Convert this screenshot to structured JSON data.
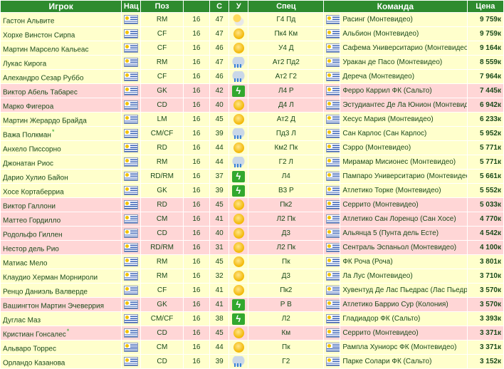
{
  "headers": {
    "player": "Игрок",
    "nat": "Нац",
    "pos": "Поз",
    "age": "",
    "s": "С",
    "u": "У",
    "spec": "Спец",
    "team": "Команда",
    "price": "Цена"
  },
  "rows": [
    {
      "name": "Гастон Альвите",
      "star": "",
      "pos": "RM",
      "age": "16",
      "s": "47",
      "weather": "cloud-sun",
      "spec": "Г4 Пд",
      "team": "Расинг (Монтевидео)",
      "price": "9 759к",
      "hl": "y"
    },
    {
      "name": "Хорхе Винстон Сирпа",
      "star": "",
      "pos": "CF",
      "age": "16",
      "s": "47",
      "weather": "sunny",
      "spec": "Пк4 Км",
      "team": "Альбион (Монтевидео)",
      "price": "9 759к",
      "hl": "y"
    },
    {
      "name": "Мартин Марсело Кальеас",
      "star": "",
      "pos": "CF",
      "age": "16",
      "s": "46",
      "weather": "sunny",
      "spec": "У4 Д",
      "team": "Сафема Университарио (Монтевидео)",
      "price": "9 164к",
      "hl": "y"
    },
    {
      "name": "Лукас Кирога",
      "star": "",
      "pos": "RM",
      "age": "16",
      "s": "47",
      "weather": "rain",
      "spec": "Ат2 Пд2",
      "team": "Уракан де Пасо (Монтевидео)",
      "price": "8 559к",
      "hl": "y"
    },
    {
      "name": "Алехандро Сезар Руббо",
      "star": "",
      "pos": "CF",
      "age": "16",
      "s": "46",
      "weather": "rain",
      "spec": "Ат2 Г2",
      "team": "Дереча (Монтевидео)",
      "price": "7 964к",
      "hl": "y"
    },
    {
      "name": "Виктор Абель Табарес",
      "star": "",
      "pos": "GK",
      "age": "16",
      "s": "42",
      "weather": "storm",
      "spec": "Л4 Р",
      "team": "Ферро Каррил ФК (Сальто)",
      "price": "7 445к",
      "hl": "p"
    },
    {
      "name": "Марко Фигероа",
      "star": "",
      "pos": "CD",
      "age": "16",
      "s": "40",
      "weather": "sunny",
      "spec": "Д4 Л",
      "team": "Эстудиантес Де Ла Юнион (Монтевидео)",
      "price": "6 942к",
      "hl": "p"
    },
    {
      "name": "Мартин Жерардо Брайда",
      "star": "",
      "pos": "LM",
      "age": "16",
      "s": "45",
      "weather": "sunny",
      "spec": "Ат2 Д",
      "team": "Хесус Мария (Монтевидео)",
      "price": "6 233к",
      "hl": "y"
    },
    {
      "name": "Важа Полкман",
      "star": "*",
      "pos": "CM/CF",
      "age": "16",
      "s": "39",
      "weather": "rain",
      "spec": "Пд3 Л",
      "team": "Сан Карлос (Сан Карлос)",
      "price": "5 952к",
      "hl": "y"
    },
    {
      "name": "Анхело Писсорно",
      "star": "",
      "pos": "RD",
      "age": "16",
      "s": "44",
      "weather": "sunny",
      "spec": "Км2 Пк",
      "team": "Сэрро (Монтевидео)",
      "price": "5 771к",
      "hl": "y"
    },
    {
      "name": "Джонатан Риос",
      "star": "",
      "pos": "RM",
      "age": "16",
      "s": "44",
      "weather": "rain",
      "spec": "Г2 Л",
      "team": "Мирамар Мисионес (Монтевидео)",
      "price": "5 771к",
      "hl": "y"
    },
    {
      "name": "Дарио Хулио Байон",
      "star": "",
      "pos": "RD/RM",
      "age": "16",
      "s": "37",
      "weather": "storm",
      "spec": "Л4",
      "team": "Пампаро Университарио (Монтевидео)",
      "price": "5 661к",
      "hl": "y"
    },
    {
      "name": "Хосе Кортаберриа",
      "star": "",
      "pos": "GK",
      "age": "16",
      "s": "39",
      "weather": "storm",
      "spec": "В3 Р",
      "team": "Атлетико Торке (Монтевидео)",
      "price": "5 552к",
      "hl": "y"
    },
    {
      "name": "Виктор Галлони",
      "star": "",
      "pos": "RD",
      "age": "16",
      "s": "45",
      "weather": "sunny",
      "spec": "Пк2",
      "team": "Серрито (Монтевидео)",
      "price": "5 033к",
      "hl": "p"
    },
    {
      "name": "Маттео Гордилло",
      "star": "",
      "pos": "CM",
      "age": "16",
      "s": "41",
      "weather": "sunny",
      "spec": "Л2 Пк",
      "team": "Атлетико Сан Лоренцо (Сан Хосе)",
      "price": "4 770к",
      "hl": "p"
    },
    {
      "name": "Родольфо Гиллен",
      "star": "",
      "pos": "CD",
      "age": "16",
      "s": "40",
      "weather": "sunny",
      "spec": "Д3",
      "team": "Альянца 5 (Пунта дель Есте)",
      "price": "4 542к",
      "hl": "p"
    },
    {
      "name": "Нестор дель Рио",
      "star": "",
      "pos": "RD/RM",
      "age": "16",
      "s": "31",
      "weather": "sunny",
      "spec": "Л2 Пк",
      "team": "Сентраль Эспаньол (Монтевидео)",
      "price": "4 100к",
      "hl": "p"
    },
    {
      "name": "Матиас Мело",
      "star": "",
      "pos": "RM",
      "age": "16",
      "s": "45",
      "weather": "sunny",
      "spec": "Пк",
      "team": "ФК Роча (Роча)",
      "price": "3 801к",
      "hl": "y"
    },
    {
      "name": "Клаудио Херман Морнироли",
      "star": "",
      "pos": "RM",
      "age": "16",
      "s": "32",
      "weather": "sunny",
      "spec": "Д3",
      "team": "Ла Лус (Монтевидео)",
      "price": "3 710к",
      "hl": "y"
    },
    {
      "name": "Ренцо Даниэль Валверде",
      "star": "",
      "pos": "CF",
      "age": "16",
      "s": "41",
      "weather": "sunny",
      "spec": "Пк2",
      "team": "Хувентуд Де Лас Пьедрас (Лас Пьедрас)",
      "price": "3 570к",
      "hl": "y"
    },
    {
      "name": "Вашингтон Мартин Эчеверрия",
      "star": "",
      "pos": "GK",
      "age": "16",
      "s": "41",
      "weather": "storm",
      "spec": "Р В",
      "team": "Атлетико Баррио Сур (Колония)",
      "price": "3 570к",
      "hl": "p"
    },
    {
      "name": "Дуглас Маз",
      "star": "",
      "pos": "CM/CF",
      "age": "16",
      "s": "38",
      "weather": "storm",
      "spec": "Л2",
      "team": "Гладиадор ФК (Сальто)",
      "price": "3 393к",
      "hl": "y"
    },
    {
      "name": "Кристиан Гонсалес",
      "star": "*",
      "pos": "CD",
      "age": "16",
      "s": "45",
      "weather": "sunny",
      "spec": "Км",
      "team": "Серрито (Монтевидео)",
      "price": "3 371к",
      "hl": "p"
    },
    {
      "name": "Альваро Торрес",
      "star": "",
      "pos": "CM",
      "age": "16",
      "s": "44",
      "weather": "sunny",
      "spec": "Пк",
      "team": "Рампла Хуниорс ФК (Монтевидео)",
      "price": "3 371к",
      "hl": "y"
    },
    {
      "name": "Орландо Казанова",
      "star": "",
      "pos": "CD",
      "age": "16",
      "s": "39",
      "weather": "rain",
      "spec": "Г2",
      "team": "Парке Солари ФК (Сальто)",
      "price": "3 152к",
      "hl": "y"
    }
  ]
}
